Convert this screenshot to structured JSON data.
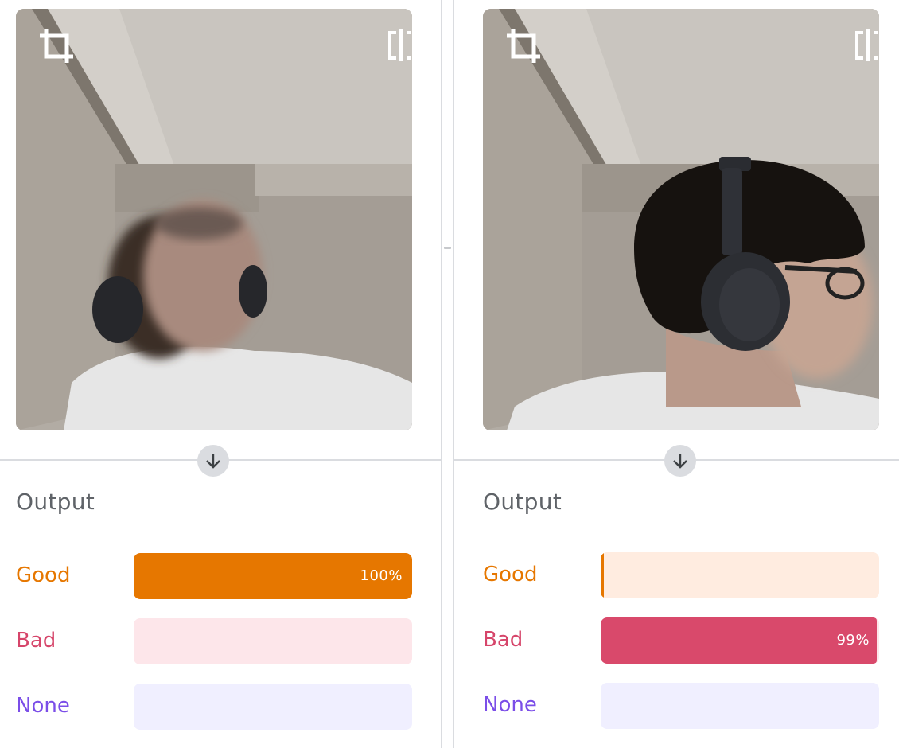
{
  "panels": [
    {
      "output_title": "Output",
      "classes": [
        {
          "label": "Good",
          "percent_text": "100%",
          "value": 1.0,
          "fill_color": "#e67700",
          "track_color": "#ffece0",
          "label_color": "#e67700"
        },
        {
          "label": "Bad",
          "percent_text": "",
          "value": 0.0,
          "fill_color": "#d9496b",
          "track_color": "#fde6ea",
          "label_color": "#d6456a"
        },
        {
          "label": "None",
          "percent_text": "",
          "value": 0.0,
          "fill_color": "#7b4ee8",
          "track_color": "#f0efff",
          "label_color": "#7b4ee8"
        }
      ]
    },
    {
      "output_title": "Output",
      "classes": [
        {
          "label": "Good",
          "percent_text": "",
          "value": 0.01,
          "fill_color": "#e67700",
          "track_color": "#ffece0",
          "label_color": "#e67700"
        },
        {
          "label": "Bad",
          "percent_text": "99%",
          "value": 0.99,
          "fill_color": "#d9496b",
          "track_color": "#fde6ea",
          "label_color": "#d6456a"
        },
        {
          "label": "None",
          "percent_text": "",
          "value": 0.0,
          "fill_color": "#7b4ee8",
          "track_color": "#f0efff",
          "label_color": "#7b4ee8"
        }
      ]
    }
  ],
  "icons": {
    "crop": "crop-icon",
    "flip": "flip-horizontal-icon",
    "arrow": "arrow-down-icon"
  }
}
